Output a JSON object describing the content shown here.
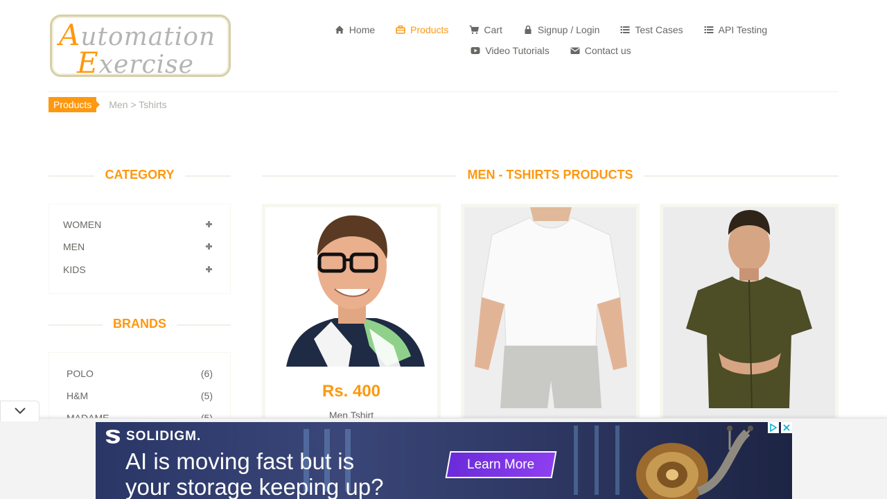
{
  "logo": {
    "line1_cap": "A",
    "line1_rest": "utomation",
    "line2_cap": "E",
    "line2_rest": "xercise"
  },
  "nav": {
    "row1": [
      {
        "label": "Home",
        "icon": "home-icon"
      },
      {
        "label": "Products",
        "icon": "briefcase-icon",
        "active": true
      },
      {
        "label": "Cart",
        "icon": "cart-icon"
      },
      {
        "label": "Signup / Login",
        "icon": "lock-icon"
      },
      {
        "label": "Test Cases",
        "icon": "list-icon"
      },
      {
        "label": "API Testing",
        "icon": "list-icon"
      }
    ],
    "row2": [
      {
        "label": "Video Tutorials",
        "icon": "youtube-play-icon"
      },
      {
        "label": "Contact us",
        "icon": "envelope-icon"
      }
    ]
  },
  "breadcrumb": {
    "active": "Products",
    "rest": "Men > Tshirts"
  },
  "sidebar": {
    "category_title": "Category",
    "categories": [
      "WOMEN",
      "MEN",
      "KIDS"
    ],
    "brands_title": "Brands",
    "brands": [
      {
        "name": "POLO",
        "count": "(6)"
      },
      {
        "name": "H&M",
        "count": "(5)"
      },
      {
        "name": "MADAME",
        "count": "(5)"
      }
    ]
  },
  "main": {
    "title": "Men - Tshirts Products",
    "products": [
      {
        "price": "Rs. 400",
        "name": "Men Tshirt"
      },
      {
        "price": "",
        "name": ""
      },
      {
        "price": "",
        "name": ""
      }
    ]
  },
  "ad": {
    "brand": "SOLIDIGM.",
    "headline_line1": "AI is moving fast but is",
    "headline_line2": "your storage keeping up?",
    "cta": "Learn More"
  },
  "colors": {
    "accent": "#fe980f",
    "text": "#696763",
    "muted": "#b3afa8"
  }
}
